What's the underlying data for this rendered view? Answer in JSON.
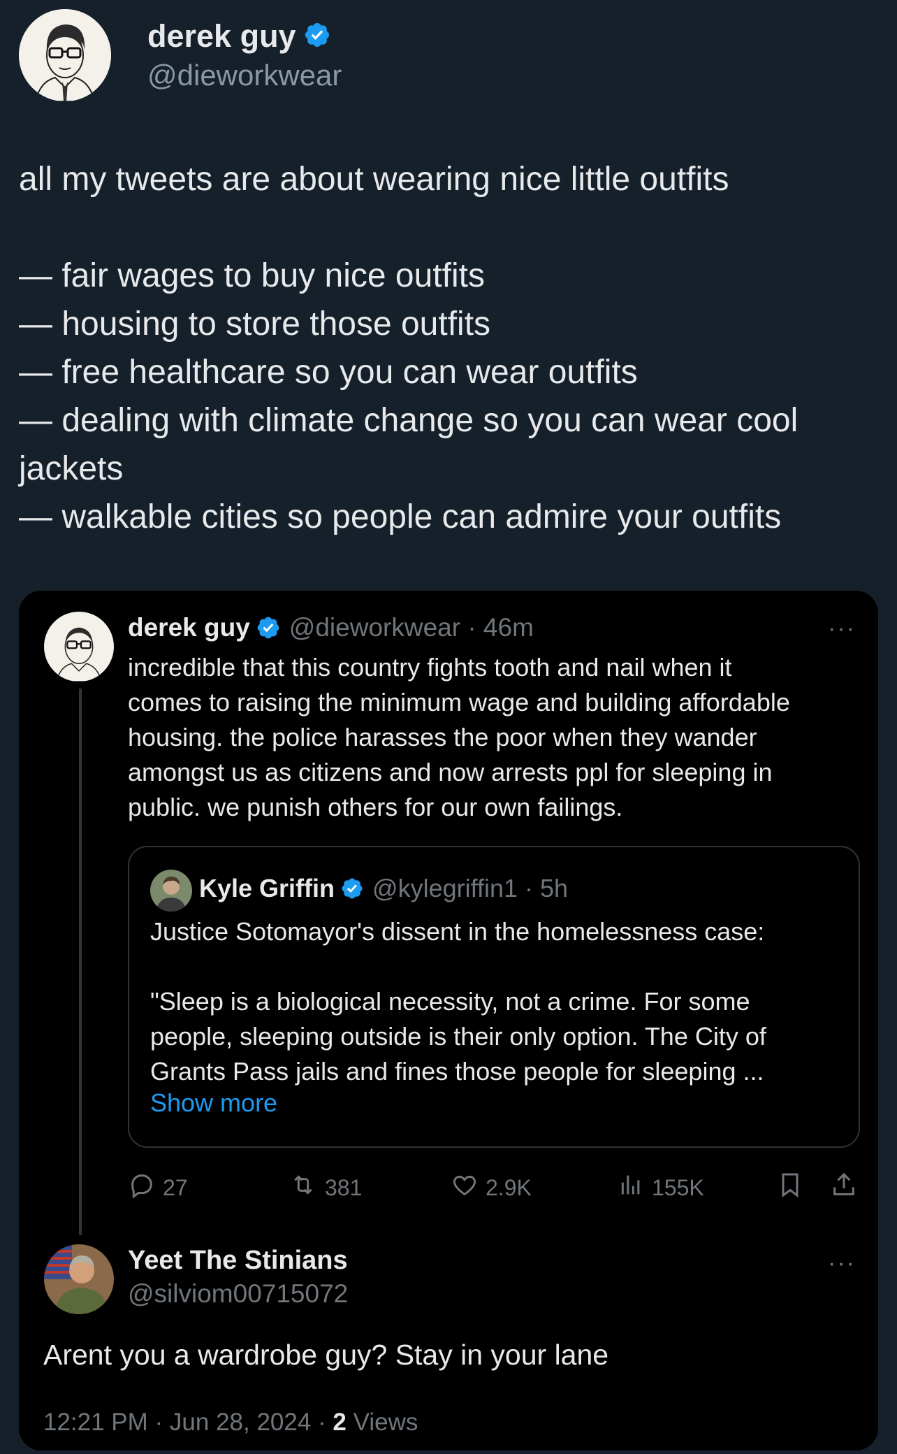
{
  "main_tweet": {
    "author_name": "derek guy",
    "author_handle": "@dieworkwear",
    "text": "all my tweets are about wearing nice little outfits\n\n— fair wages to buy nice outfits\n— housing to store those outfits\n— free healthcare so you can wear outfits\n— dealing with climate change so you can wear cool jackets\n— walkable cities so people can admire your outfits"
  },
  "thread": {
    "tweet": {
      "author_name": "derek guy",
      "author_handle": "@dieworkwear · 46m",
      "more": "···",
      "text": "incredible that this country fights tooth and nail when it\ncomes to raising the minimum wage and building affordable\nhousing. the police harasses the poor when they wander\namongst us as citizens and now arrests ppl for sleeping in\npublic. we punish others for our own failings."
    },
    "quote": {
      "author_name": "Kyle Griffin",
      "author_handle": "@kylegriffin1 · 5h",
      "text": "Justice Sotomayor's dissent in the homelessness case:\n\n\"Sleep is a biological necessity, not a crime. For some\npeople, sleeping outside is their only option. The City of\nGrants Pass jails and fines those people for sleeping ...",
      "show_more": "Show more"
    },
    "actions": {
      "replies": "27",
      "reposts": "381",
      "likes": "2.9K",
      "views": "155K"
    },
    "reply": {
      "author_name": "Yeet The Stinians",
      "author_handle": "@silviom00715072",
      "more": "···",
      "text": "Arent you a wardrobe guy? Stay in your lane",
      "timestamp": "12:21 PM · Jun 28, 2024 · ",
      "views_count": "2",
      "views_label": " Views"
    }
  },
  "colors": {
    "background": "#15202b",
    "card_background": "#000000",
    "verified_blue": "#1d9bf0",
    "muted_text": "#71767b"
  },
  "icons": [
    "verified-badge-icon",
    "reply-icon",
    "repost-icon",
    "like-icon",
    "views-icon",
    "bookmark-icon",
    "share-icon",
    "more-icon"
  ]
}
